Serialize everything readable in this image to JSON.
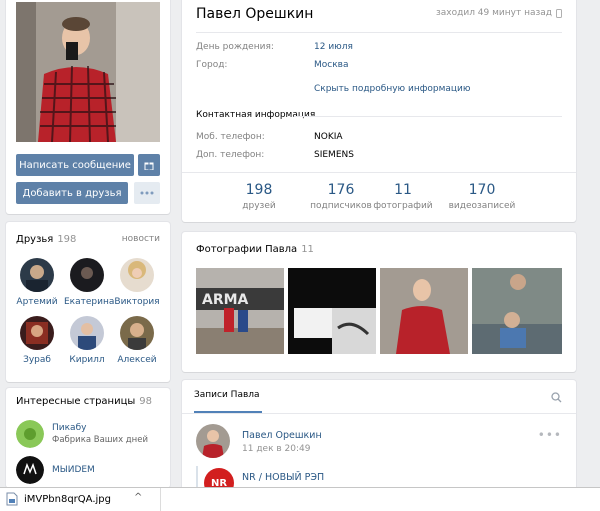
{
  "profile": {
    "name": "Павел Орешкин",
    "online": "заходил 49 минут назад",
    "info": [
      {
        "label": "День рождения:",
        "value": "12 июля",
        "link": true
      },
      {
        "label": "Город:",
        "value": "Москва",
        "link": true
      }
    ],
    "more_link": "Скрыть подробную информацию",
    "contact_title": "Контактная информация",
    "contacts": [
      {
        "label": "Моб. телефон:",
        "value": "NOKIA"
      },
      {
        "label": "Доп. телефон:",
        "value": "SIEMENS"
      }
    ],
    "counters": [
      {
        "num": "198",
        "label": "друзей"
      },
      {
        "num": "176",
        "label": "подписчиков"
      },
      {
        "num": "11",
        "label": "фотографий"
      },
      {
        "num": "170",
        "label": "видеозаписей"
      }
    ]
  },
  "actions": {
    "message": "Написать сообщение",
    "add_friend": "Добавить в друзья",
    "gift_icon": "gift-icon",
    "more_icon": "more-dots-icon"
  },
  "friends": {
    "title": "Друзья",
    "count": "198",
    "news": "новости",
    "items": [
      {
        "name": "Артемий"
      },
      {
        "name": "Екатерина"
      },
      {
        "name": "Виктория"
      },
      {
        "name": "Зураб"
      },
      {
        "name": "Кирилл"
      },
      {
        "name": "Алексей"
      }
    ]
  },
  "pages": {
    "title": "Интересные страницы",
    "count": "98",
    "items": [
      {
        "name": "Пикабу",
        "desc": "Фабрика Ваших дней"
      },
      {
        "name": "МЫИDEM",
        "desc": ""
      }
    ]
  },
  "photos": {
    "title": "Фотографии Павла",
    "count": "11"
  },
  "wall": {
    "tab": "Записи Павла",
    "search_icon": "search-icon",
    "post": {
      "author": "Павел Орешкин",
      "date": "11 дек в 20:49",
      "repost_name": "NR / НОВЫЙ РЭП",
      "repost_logo": "NR"
    }
  },
  "download": {
    "file": "iMVPbn8qrQA.jpg",
    "chevron": "^"
  },
  "colors": {
    "accent": "#5e81a8",
    "link": "#2a5885",
    "background": "#edeef0"
  }
}
